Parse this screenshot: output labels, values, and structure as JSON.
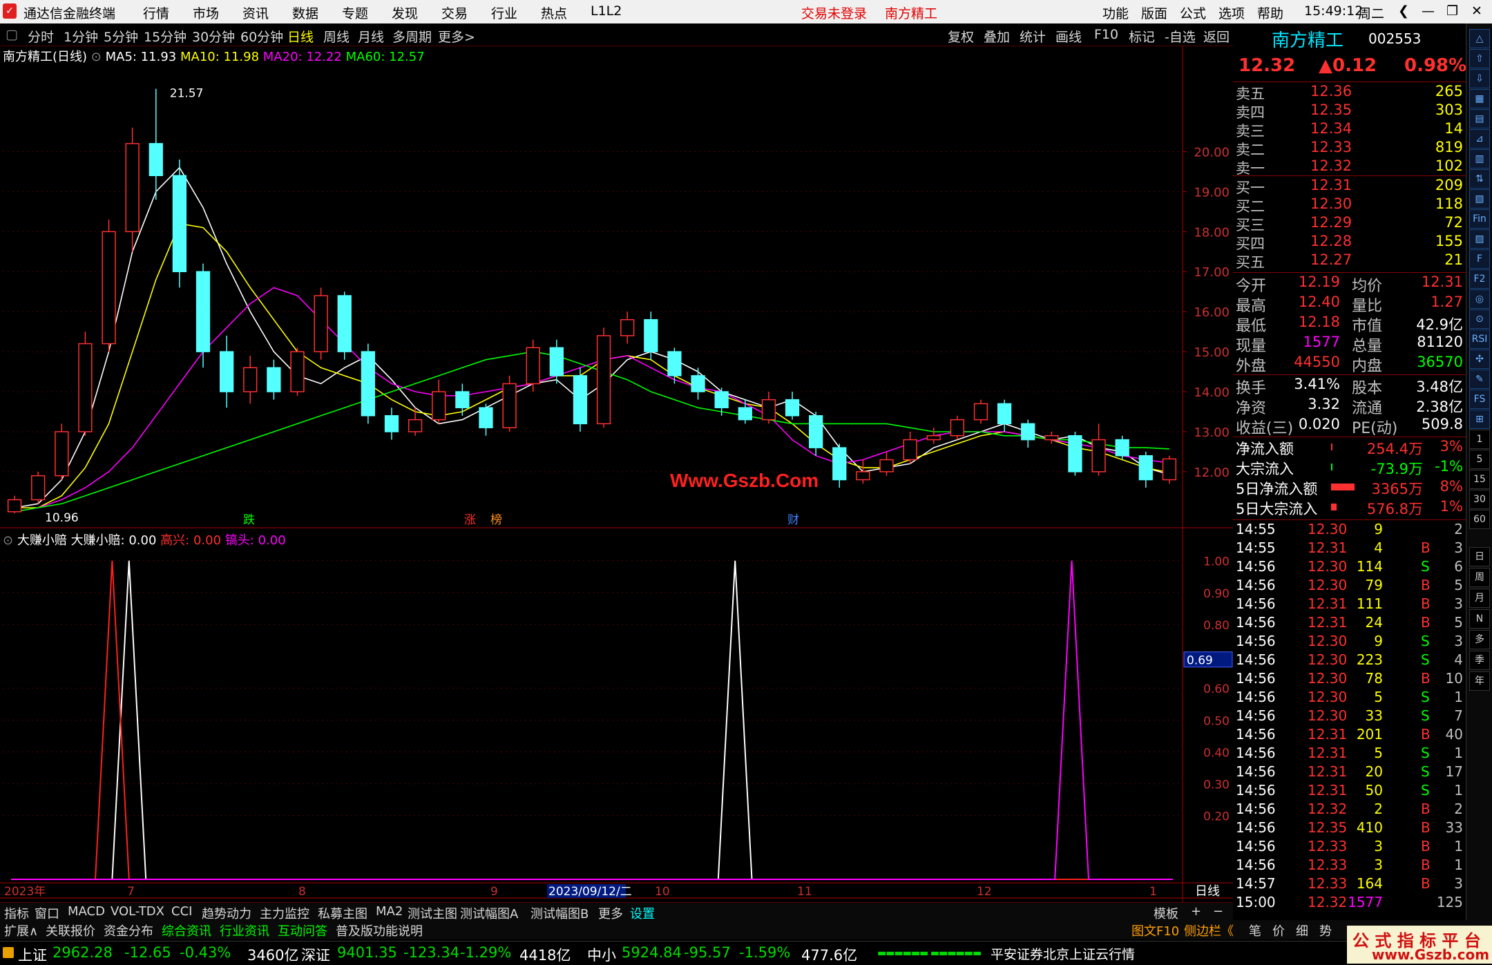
{
  "titlebar": {
    "app": "通达信金融终端",
    "menus": [
      "行情",
      "市场",
      "资讯",
      "数据",
      "专题",
      "发现",
      "交易",
      "行业",
      "热点",
      "L1L2"
    ],
    "login": "交易未登录",
    "stock": "南方精工",
    "right_menus": [
      "功能",
      "版面",
      "公式",
      "选项",
      "帮助"
    ],
    "time": "15:49:12",
    "weekday": "周二"
  },
  "toolbar": {
    "periods": [
      "分时",
      "1分钟",
      "5分钟",
      "15分钟",
      "30分钟",
      "60分钟",
      "日线",
      "周线",
      "月线",
      "多周期",
      "更多>"
    ],
    "active": "日线",
    "right_tools": [
      "复权",
      "叠加",
      "统计",
      "画线",
      "F10",
      "标记",
      "-自选",
      "返回"
    ]
  },
  "legend_main": {
    "title": "南方精工(日线)",
    "ma5": "MA5: 11.93",
    "ma10": "MA10: 11.98",
    "ma20": "MA20: 12.22",
    "ma60": "MA60: 12.57"
  },
  "legend_ind": {
    "name": "大赚小赔",
    "label": "大赚小赔: 0.00",
    "gx": "高兴: 0.00",
    "zt": "镐头: 0.00"
  },
  "chart_data": [
    {
      "type": "candlestick",
      "title": "南方精工(日线)",
      "y_ticks": [
        "20.00",
        "19.00",
        "18.00",
        "17.00",
        "16.00",
        "15.00",
        "14.00",
        "13.00",
        "12.00"
      ],
      "ylim": [
        10.6,
        22.2
      ],
      "high_label": "21.57",
      "low_label": "10.96",
      "x_labels": [
        "2023年",
        "7",
        "8",
        "9",
        "2023/09/12/二",
        "10",
        "11",
        "12",
        "1"
      ],
      "event_markers": [
        "跌",
        "涨",
        "榜",
        "财"
      ],
      "series": [
        {
          "name": "MA5",
          "color": "#ffffff"
        },
        {
          "name": "MA10",
          "color": "#ffff00"
        },
        {
          "name": "MA20",
          "color": "#ff00ff"
        },
        {
          "name": "MA60",
          "color": "#00ff00"
        }
      ],
      "ma_values": {
        "MA5": [
          11.1,
          11.2,
          11.8,
          13.0,
          15.0,
          17.5,
          19.0,
          19.6,
          18.6,
          17.2,
          16.0,
          15.0,
          14.4,
          14.2,
          14.6,
          14.9,
          14.3,
          13.6,
          13.2,
          13.3,
          13.6,
          13.9,
          14.2,
          14.3,
          13.8,
          14.2,
          14.8,
          15.0,
          14.8,
          14.5,
          14.0,
          13.8,
          13.6,
          13.8,
          13.4,
          12.6,
          12.0,
          12.1,
          12.2,
          12.6,
          12.8,
          13.0,
          13.2,
          13.0,
          12.8,
          12.9,
          12.6,
          12.5,
          12.1,
          11.93
        ],
        "MA10": [
          11.1,
          11.1,
          11.4,
          12.1,
          13.2,
          15.0,
          16.8,
          18.2,
          18.1,
          17.5,
          16.6,
          15.8,
          15.0,
          14.6,
          14.4,
          14.2,
          13.8,
          13.5,
          13.4,
          13.5,
          13.8,
          14.1,
          14.2,
          14.4,
          14.4,
          14.8,
          14.9,
          14.8,
          14.4,
          14.1,
          13.9,
          13.7,
          13.6,
          13.2,
          12.7,
          12.3,
          12.1,
          12.1,
          12.3,
          12.5,
          12.7,
          12.9,
          13.0,
          12.9,
          12.8,
          12.6,
          12.5,
          12.3,
          12.1,
          11.98
        ],
        "MA20": [
          11.0,
          11.1,
          11.3,
          11.6,
          12.0,
          12.6,
          13.4,
          14.2,
          15.0,
          15.6,
          16.2,
          16.6,
          16.4,
          15.8,
          15.2,
          14.6,
          14.2,
          14.0,
          13.9,
          13.9,
          14.0,
          14.1,
          14.2,
          14.4,
          14.6,
          14.8,
          14.9,
          14.6,
          14.3,
          14.1,
          14.0,
          13.7,
          13.4,
          12.8,
          12.4,
          12.2,
          12.3,
          12.5,
          12.7,
          12.9,
          13.0,
          13.0,
          13.0,
          12.9,
          12.8,
          12.7,
          12.6,
          12.4,
          12.3,
          12.22
        ],
        "MA60": [
          11.0,
          11.1,
          11.2,
          11.4,
          11.6,
          11.8,
          12.0,
          12.2,
          12.4,
          12.6,
          12.8,
          13.0,
          13.2,
          13.4,
          13.6,
          13.8,
          14.0,
          14.2,
          14.4,
          14.6,
          14.8,
          14.9,
          15.0,
          14.9,
          14.7,
          14.5,
          14.3,
          14.0,
          13.8,
          13.6,
          13.5,
          13.4,
          13.3,
          13.2,
          13.2,
          13.2,
          13.2,
          13.2,
          13.1,
          13.0,
          13.0,
          13.0,
          12.9,
          12.9,
          12.8,
          12.8,
          12.7,
          12.6,
          12.6,
          12.57
        ]
      },
      "candles": [
        [
          11.0,
          11.3,
          10.96,
          11.4
        ],
        [
          11.3,
          11.9,
          11.2,
          12.0
        ],
        [
          11.9,
          13.0,
          11.8,
          13.2
        ],
        [
          13.0,
          15.2,
          12.9,
          15.5
        ],
        [
          15.2,
          18.0,
          15.0,
          18.3
        ],
        [
          18.0,
          20.2,
          17.5,
          20.6
        ],
        [
          20.2,
          19.4,
          18.8,
          21.57
        ],
        [
          19.4,
          17.0,
          16.6,
          19.8
        ],
        [
          17.0,
          15.0,
          14.6,
          17.2
        ],
        [
          15.0,
          14.0,
          13.6,
          15.4
        ],
        [
          14.0,
          14.6,
          13.7,
          14.9
        ],
        [
          14.6,
          14.0,
          13.8,
          14.8
        ],
        [
          14.0,
          15.0,
          13.9,
          15.1
        ],
        [
          15.0,
          16.4,
          14.8,
          16.6
        ],
        [
          16.4,
          15.0,
          14.8,
          16.5
        ],
        [
          15.0,
          13.4,
          13.2,
          15.2
        ],
        [
          13.4,
          13.0,
          12.8,
          13.6
        ],
        [
          13.0,
          13.3,
          12.9,
          13.6
        ],
        [
          13.3,
          14.0,
          13.2,
          14.3
        ],
        [
          14.0,
          13.6,
          13.4,
          14.2
        ],
        [
          13.6,
          13.1,
          12.9,
          13.7
        ],
        [
          13.1,
          14.2,
          13.0,
          14.4
        ],
        [
          14.2,
          15.1,
          14.0,
          15.3
        ],
        [
          15.1,
          14.4,
          14.2,
          15.3
        ],
        [
          14.4,
          13.2,
          13.0,
          14.6
        ],
        [
          13.2,
          15.4,
          13.1,
          15.6
        ],
        [
          15.4,
          15.8,
          15.2,
          16.0
        ],
        [
          15.8,
          15.0,
          14.8,
          16.0
        ],
        [
          15.0,
          14.4,
          14.2,
          15.1
        ],
        [
          14.4,
          14.0,
          13.8,
          14.6
        ],
        [
          14.0,
          13.6,
          13.4,
          14.1
        ],
        [
          13.6,
          13.3,
          13.2,
          13.8
        ],
        [
          13.3,
          13.8,
          13.2,
          14.0
        ],
        [
          13.8,
          13.4,
          13.3,
          14.0
        ],
        [
          13.4,
          12.6,
          12.4,
          13.5
        ],
        [
          12.6,
          11.8,
          11.6,
          12.7
        ],
        [
          11.8,
          12.0,
          11.7,
          12.3
        ],
        [
          12.0,
          12.3,
          11.9,
          12.5
        ],
        [
          12.3,
          12.8,
          12.2,
          13.0
        ],
        [
          12.8,
          12.9,
          12.7,
          13.1
        ],
        [
          12.9,
          13.3,
          12.8,
          13.4
        ],
        [
          13.3,
          13.7,
          13.2,
          13.8
        ],
        [
          13.7,
          13.2,
          13.0,
          13.8
        ],
        [
          13.2,
          12.8,
          12.6,
          13.3
        ],
        [
          12.8,
          12.9,
          12.7,
          13.0
        ],
        [
          12.9,
          12.0,
          11.9,
          13.0
        ],
        [
          12.0,
          12.8,
          11.9,
          13.2
        ],
        [
          12.8,
          12.4,
          12.3,
          12.9
        ],
        [
          12.4,
          11.8,
          11.6,
          12.5
        ],
        [
          11.8,
          12.32,
          11.7,
          12.4
        ]
      ]
    },
    {
      "type": "line",
      "title": "大赚小赔",
      "y_ticks": [
        "1.00",
        "0.90",
        "0.80",
        "0.69",
        "0.60",
        "0.50",
        "0.40",
        "0.30",
        "0.20"
      ],
      "ylim": [
        0,
        1.06
      ],
      "cursor_value": "0.69",
      "series": [
        {
          "name": "大赚小赔",
          "color": "#ffffff",
          "peaks_at_index": [
            7,
            43
          ]
        },
        {
          "name": "高兴",
          "color": "#ff2020",
          "peaks_at_index": [
            6
          ]
        },
        {
          "name": "镐头",
          "color": "#ff00ff",
          "peaks_at_index": [
            63
          ]
        }
      ],
      "points_count": 70
    }
  ],
  "quote": {
    "name": "南方精工",
    "code": "002553",
    "price": "12.32",
    "change": "▲0.12",
    "pct": "0.98%",
    "sell": [
      {
        "label": "卖五",
        "price": "12.36",
        "vol": "265"
      },
      {
        "label": "卖四",
        "price": "12.35",
        "vol": "303"
      },
      {
        "label": "卖三",
        "price": "12.34",
        "vol": "14"
      },
      {
        "label": "卖二",
        "price": "12.33",
        "vol": "819"
      },
      {
        "label": "卖一",
        "price": "12.32",
        "vol": "102"
      }
    ],
    "buy": [
      {
        "label": "买一",
        "price": "12.31",
        "vol": "209"
      },
      {
        "label": "买二",
        "price": "12.30",
        "vol": "118"
      },
      {
        "label": "买三",
        "price": "12.29",
        "vol": "72"
      },
      {
        "label": "买四",
        "price": "12.28",
        "vol": "155"
      },
      {
        "label": "买五",
        "price": "12.27",
        "vol": "21"
      }
    ],
    "stats": [
      [
        "今开",
        "12.19",
        "均价",
        "12.31"
      ],
      [
        "最高",
        "12.40",
        "量比",
        "1.27"
      ],
      [
        "最低",
        "12.18",
        "市值",
        "42.9亿"
      ],
      [
        "现量",
        "1577",
        "总量",
        "81120"
      ],
      [
        "外盘",
        "44550",
        "内盘",
        "36570"
      ]
    ],
    "stats2": [
      [
        "换手",
        "3.41%",
        "股本",
        "3.48亿"
      ],
      [
        "净资",
        "3.32",
        "流通",
        "2.38亿"
      ],
      [
        "收益(三)",
        "0.020",
        "PE(动)",
        "509.8"
      ]
    ],
    "flows": [
      [
        "净流入额",
        "254.4万",
        "3%"
      ],
      [
        "大宗流入",
        "-73.9万",
        "-1%"
      ],
      [
        "5日净流入额",
        "3365万",
        "8%"
      ],
      [
        "5日大宗流入",
        "576.8万",
        "1%"
      ]
    ],
    "ticks": [
      [
        "14:55",
        "12.30",
        "9",
        "",
        "2"
      ],
      [
        "14:55",
        "12.31",
        "4",
        "B",
        "3"
      ],
      [
        "14:56",
        "12.30",
        "114",
        "S",
        "6"
      ],
      [
        "14:56",
        "12.30",
        "79",
        "B",
        "5"
      ],
      [
        "14:56",
        "12.31",
        "111",
        "B",
        "3"
      ],
      [
        "14:56",
        "12.31",
        "24",
        "B",
        "5"
      ],
      [
        "14:56",
        "12.30",
        "9",
        "S",
        "3"
      ],
      [
        "14:56",
        "12.30",
        "223",
        "S",
        "4"
      ],
      [
        "14:56",
        "12.30",
        "78",
        "B",
        "10"
      ],
      [
        "14:56",
        "12.30",
        "5",
        "S",
        "1"
      ],
      [
        "14:56",
        "12.30",
        "33",
        "S",
        "7"
      ],
      [
        "14:56",
        "12.31",
        "201",
        "B",
        "40"
      ],
      [
        "14:56",
        "12.31",
        "5",
        "S",
        "1"
      ],
      [
        "14:56",
        "12.31",
        "20",
        "S",
        "17"
      ],
      [
        "14:56",
        "12.31",
        "50",
        "S",
        "1"
      ],
      [
        "14:56",
        "12.32",
        "2",
        "B",
        "2"
      ],
      [
        "14:56",
        "12.35",
        "410",
        "B",
        "33"
      ],
      [
        "14:56",
        "12.33",
        "3",
        "B",
        "1"
      ],
      [
        "14:56",
        "12.33",
        "3",
        "B",
        "1"
      ],
      [
        "14:57",
        "12.33",
        "164",
        "B",
        "3"
      ],
      [
        "15:00",
        "12.32",
        "1577",
        "",
        "125"
      ]
    ]
  },
  "side_icons": [
    "△",
    "⇧",
    "⇩",
    "▦",
    "▤",
    "⊿",
    "▥",
    "⇅",
    "▧",
    "Fin",
    "▨",
    "F",
    "F2",
    "◎",
    "⊙",
    "RSI",
    "✣",
    "✎",
    "FS",
    "⊞",
    "1",
    "5",
    "15",
    "30",
    "60",
    "日",
    "周",
    "月",
    "N",
    "多",
    "季",
    "年"
  ],
  "tabsbar": {
    "items": [
      "指标",
      "窗口",
      "MACD",
      "VOL-TDX",
      "CCI",
      "趋势动力",
      "主力监控",
      "私募主图",
      "MA2",
      "测试主图",
      "测试幅图A",
      "测试幅图B",
      "更多",
      "设置"
    ],
    "right": [
      "模板",
      "+",
      "−"
    ]
  },
  "bottom2": {
    "items": [
      "扩展∧",
      "关联报价",
      "资金分布",
      "综合资讯",
      "行业资讯",
      "互动问答",
      "普及版功能说明"
    ],
    "right": [
      "图文F10",
      "侧边栏《",
      "笔",
      "价",
      "细",
      "势"
    ]
  },
  "daily_label": "日线",
  "status": {
    "sh": "上证",
    "sh_v": "2962.28",
    "sh_c": "-12.65",
    "sh_p": "-0.43%",
    "sh_a": "3460亿",
    "sz": "深证",
    "sz_v": "9401.35",
    "sz_c": "-123.34",
    "sz_p": "-1.29%",
    "sz_a": "4418亿",
    "zx": "中小",
    "zx_v": "5924.84",
    "zx_c": "-95.57",
    "zx_p": "-1.59%",
    "zx_a": "477.6亿",
    "server": "平安证券北京上证云行情"
  },
  "watermark": "Www.Gszb.Com",
  "corner": {
    "line1": "公 式 指 标 平 台",
    "line2": "www.Gszb.com"
  }
}
